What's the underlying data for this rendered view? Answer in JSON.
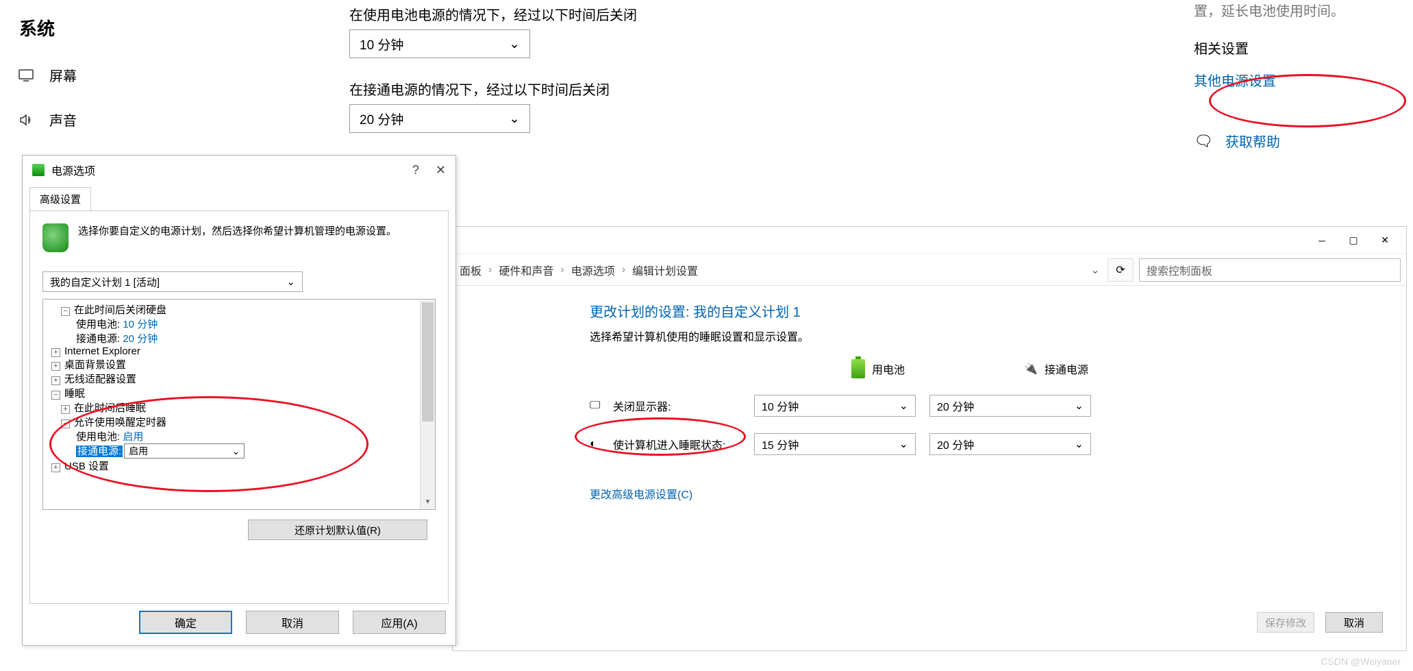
{
  "sidebar": {
    "title": "系统",
    "items": [
      {
        "icon": "monitor",
        "label": "屏幕"
      },
      {
        "icon": "sound",
        "label": "声音"
      }
    ]
  },
  "settings_page": {
    "battery_label": "在使用电池电源的情况下，经过以下时间后关闭",
    "battery_value": "10 分钟",
    "plugged_label": "在接通电源的情况下，经过以下时间后关闭",
    "plugged_value": "20 分钟",
    "top_right_hint": "置，延长电池使用时间。",
    "related_heading": "相关设置",
    "related_link": "其他电源设置",
    "help_link": "获取帮助"
  },
  "control_panel": {
    "breadcrumb": [
      "面板",
      "硬件和声音",
      "电源选项",
      "编辑计划设置"
    ],
    "search_placeholder": "搜索控制面板",
    "heading": "更改计划的设置: 我的自定义计划 1",
    "subheading": "选择希望计算机使用的睡眠设置和显示设置。",
    "col_battery": "用电池",
    "col_plugged": "接通电源",
    "row_display": "关闭显示器:",
    "row_sleep": "使计算机进入睡眠状态:",
    "display_battery": "10 分钟",
    "display_plugged": "20 分钟",
    "sleep_battery": "15 分钟",
    "sleep_plugged": "20 分钟",
    "advanced_link": "更改高级电源设置(C)",
    "save_btn": "保存修改",
    "cancel_btn": "取消"
  },
  "dialog": {
    "title": "电源选项",
    "tab": "高级设置",
    "desc": "选择你要自定义的电源计划，然后选择你希望计算机管理的电源设置。",
    "plan": "我的自定义计划 1 [活动]",
    "tree": {
      "hd_close": "在此时间后关闭硬盘",
      "hd_batt_label": "使用电池:",
      "hd_batt_val": "10 分钟",
      "hd_ac_label": "接通电源:",
      "hd_ac_val": "20 分钟",
      "ie": "Internet Explorer",
      "bg": "桌面背景设置",
      "wifi": "无线适配器设置",
      "sleep": "睡眠",
      "sleep_after": "在此时间后睡眠",
      "wake": "允许使用唤醒定时器",
      "wake_batt_label": "使用电池:",
      "wake_batt_val": "启用",
      "wake_ac_label": "接通电源:",
      "wake_ac_val": "启用",
      "usb": "USB 设置"
    },
    "restore": "还原计划默认值(R)",
    "ok": "确定",
    "cancel": "取消",
    "apply": "应用(A)"
  },
  "watermark": "CSDN @Weiyaner"
}
